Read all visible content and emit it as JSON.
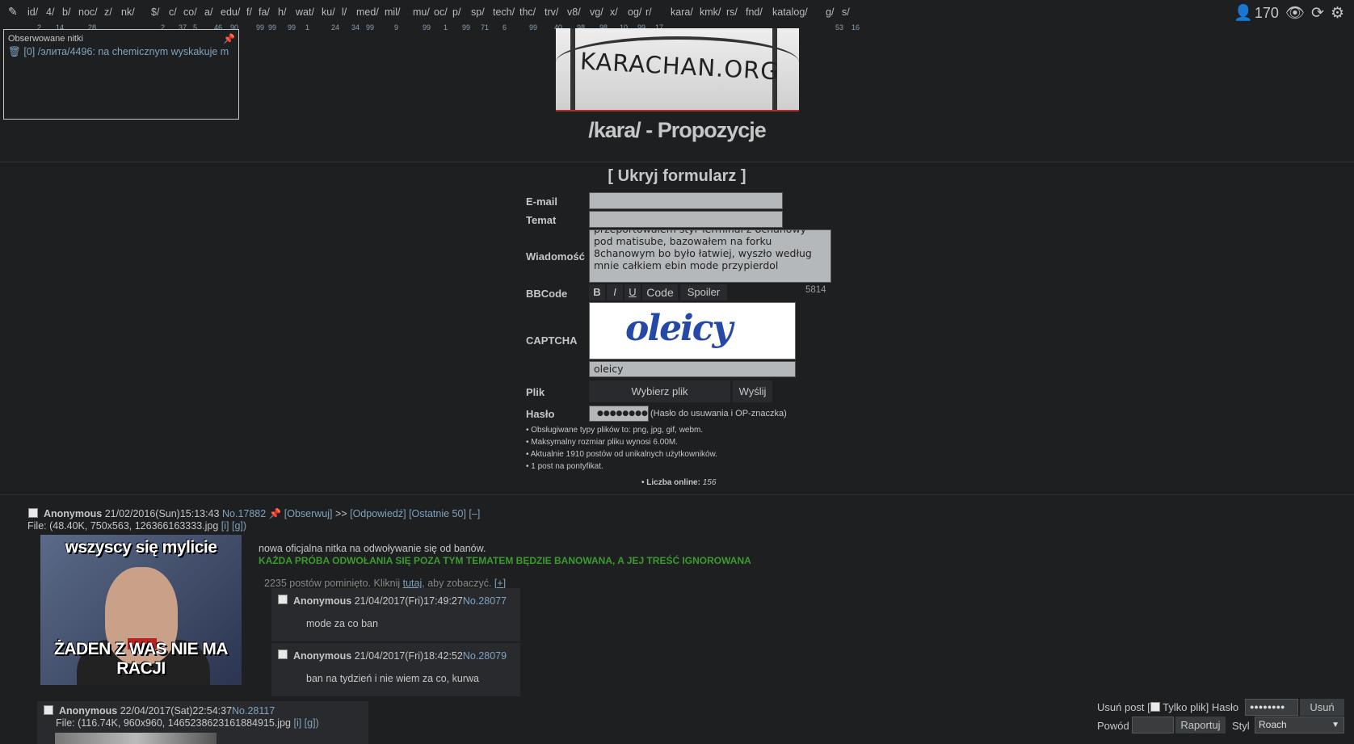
{
  "nav": {
    "boards": [
      {
        "label": "id/",
        "count": "2"
      },
      {
        "label": "4/",
        "count": "14"
      },
      {
        "label": "b/",
        "count": ""
      },
      {
        "label": "noc/",
        "count": "28"
      },
      {
        "label": "z/",
        "count": ""
      },
      {
        "label": "nk/",
        "count": ""
      },
      {
        "label": "$/",
        "count": "2"
      },
      {
        "label": "c/",
        "count": "37"
      },
      {
        "label": "co/",
        "count": "5"
      },
      {
        "label": "a/",
        "count": "46"
      },
      {
        "label": "edu/",
        "count": "90"
      },
      {
        "label": "f/",
        "count": "99"
      },
      {
        "label": "fa/",
        "count": "99"
      },
      {
        "label": "h/",
        "count": "99"
      },
      {
        "label": "wat/",
        "count": "1"
      },
      {
        "label": "ku/",
        "count": "24"
      },
      {
        "label": "l/",
        "count": "34"
      },
      {
        "label": "med/",
        "count": "99"
      },
      {
        "label": "mil/",
        "count": "9"
      },
      {
        "label": "mu/",
        "count": "99"
      },
      {
        "label": "oc/",
        "count": "1"
      },
      {
        "label": "p/",
        "count": "99"
      },
      {
        "label": "sp/",
        "count": "71"
      },
      {
        "label": "tech/",
        "count": "6"
      },
      {
        "label": "thc/",
        "count": "99"
      },
      {
        "label": "trv/",
        "count": "40"
      },
      {
        "label": "v8/",
        "count": "98"
      },
      {
        "label": "vg/",
        "count": "98"
      },
      {
        "label": "x/",
        "count": "10"
      },
      {
        "label": "og/",
        "count": "99"
      },
      {
        "label": "r/",
        "count": "17"
      },
      {
        "label": "kara/",
        "count": ""
      },
      {
        "label": "kmk/",
        "count": ""
      },
      {
        "label": "rs/",
        "count": ""
      },
      {
        "label": "fnd/",
        "count": ""
      },
      {
        "label": "katalog/",
        "count": ""
      },
      {
        "label": "g/",
        "count": "53"
      },
      {
        "label": "s/",
        "count": "16"
      }
    ],
    "online_count": "170"
  },
  "watched": {
    "title": "Obserwowane nitki",
    "item": "[0] /элита/4496: na chemicznym wyskakuje m"
  },
  "banner_text": "KARACHAN.ORG",
  "board_title": "/kara/ - Propozycje",
  "form": {
    "toggle": "[ Ukryj formularz ]",
    "email_label": "E-mail",
    "subject_label": "Temat",
    "message_label": "Wiadomość",
    "message_value": "przeportowałem styl Terminal z 8chanowy pod matisube, bazowałem na forku 8chanowym bo było łatwiej, wyszło według mnie całkiem ebin mode przypierdol",
    "char_count": "5814",
    "bbcode_label": "BBCode",
    "bbcode": {
      "bold": "B",
      "italic": "I",
      "underline": "U",
      "code": "Code",
      "spoiler": "Spoiler"
    },
    "captcha_label": "CAPTCHA",
    "captcha_image_text": "oleicy",
    "captcha_value": "oleicy",
    "file_label": "Plik",
    "file_button": "Wybierz plik",
    "send_button": "Wyślij",
    "password_label": "Hasło",
    "password_value": "●●●●●●●●",
    "password_hint": "(Hasło do usuwania i OP-znaczka)",
    "rules": [
      "• Obsługiwane typy plików to: png, jpg, gif, webm.",
      "• Maksymalny rozmiar pliku wynosi 6.00M.",
      "• Aktualnie 1910 postów od unikalnych użytkowników.",
      "• 1 post na pontyfikat."
    ],
    "online_label": "• Liczba online:",
    "online_value": "156"
  },
  "thread": {
    "op": {
      "name": "Anonymous",
      "date": "21/02/2016(Sun)15:13:43",
      "no": "No.17882",
      "watch": "[Obserwuj]",
      "arrows": ">>",
      "reply": "[Odpowiedź]",
      "last50": "[Ostatnie 50]",
      "hide": "[–]",
      "file_info": "File: (48.40K, 750x563, 126366163333.jpg",
      "file_links": "[i] [g])",
      "image_top": "wszyscy się mylicie",
      "image_bottom": "ŻADEN Z WAS NIE MA RACJI",
      "text": "nowa oficjalna nitka na odwoływanie się od banów.",
      "warning": "KAŻDA PRÓBA ODWOŁANIA SIĘ POZA TYM TEMATEM BĘDZIE BANOWANA, A JEJ TREŚĆ IGNOROWANA"
    },
    "omitted_prefix": "2235 postów pominięto. Kliknij ",
    "omitted_link": "tutaj",
    "omitted_suffix": ", aby zobaczyć.",
    "expand": "[+]",
    "replies": [
      {
        "name": "Anonymous",
        "date": "21/04/2017(Fri)17:49:27",
        "no": "No.28077",
        "text": "mode za co ban"
      },
      {
        "name": "Anonymous",
        "date": "21/04/2017(Fri)18:42:52",
        "no": "No.28079",
        "text": "ban na tydzień i nie wiem za co, kurwa"
      }
    ]
  },
  "thread2": {
    "name": "Anonymous",
    "date": "22/04/2017(Sat)22:54:37",
    "no": "No.28117",
    "file_info": "File: (116.74K, 960x960, 1465238623161884915.jpg",
    "file_links": "[i] [g])"
  },
  "delete": {
    "delete_label": "Usuń post [",
    "file_only": "Tylko plik] Hasło",
    "password": "●●●●●●●●",
    "delete_button": "Usuń",
    "reason_label": "Powód",
    "report_button": "Raportuj",
    "style_label": "Styl",
    "style_value": "Roach"
  }
}
